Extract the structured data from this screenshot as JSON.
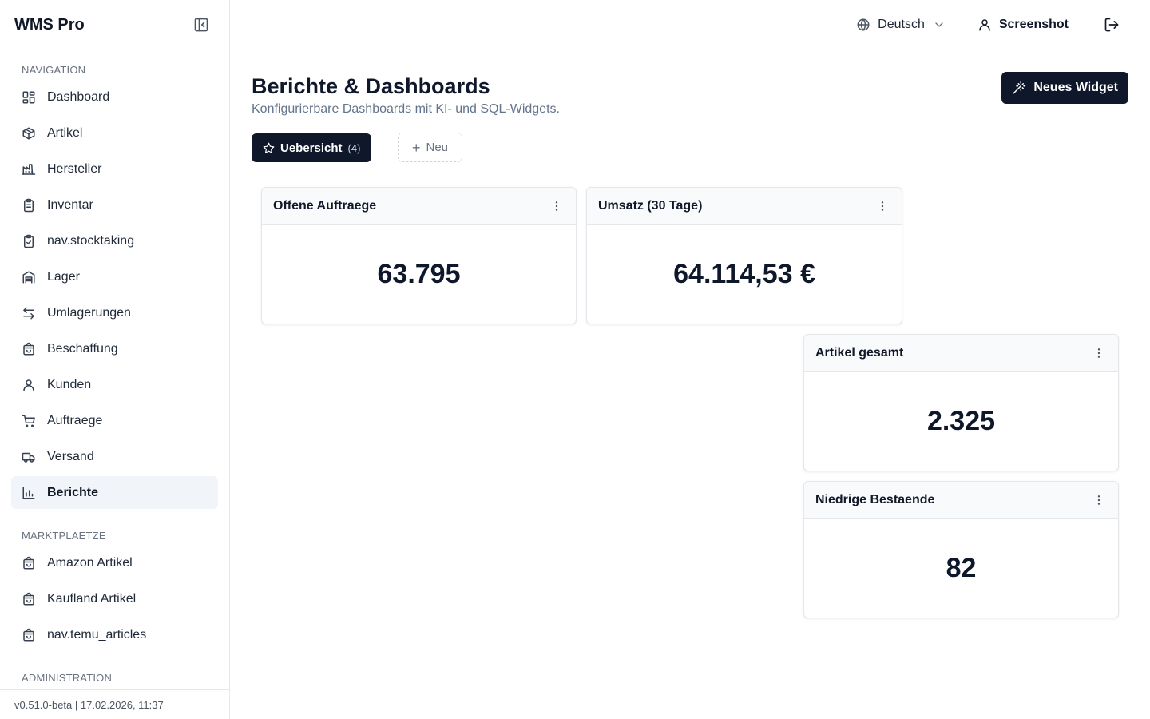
{
  "app": {
    "title": "WMS Pro",
    "version": "v0.51.0-beta | 17.02.2026, 11:37"
  },
  "sidebar": {
    "sections": [
      {
        "title": "NAVIGATION"
      },
      {
        "title": "MARKTPLAETZE"
      },
      {
        "title": "ADMINISTRATION"
      }
    ],
    "navigation": [
      {
        "label": "Dashboard",
        "icon": "layout-grid-icon"
      },
      {
        "label": "Artikel",
        "icon": "package-icon"
      },
      {
        "label": "Hersteller",
        "icon": "factory-icon"
      },
      {
        "label": "Inventar",
        "icon": "clipboard-list-icon"
      },
      {
        "label": "nav.stocktaking",
        "icon": "clipboard-check-icon"
      },
      {
        "label": "Lager",
        "icon": "warehouse-icon"
      },
      {
        "label": "Umlagerungen",
        "icon": "arrow-left-right-icon"
      },
      {
        "label": "Beschaffung",
        "icon": "shopping-bag-icon"
      },
      {
        "label": "Kunden",
        "icon": "user-icon"
      },
      {
        "label": "Auftraege",
        "icon": "shopping-cart-icon"
      },
      {
        "label": "Versand",
        "icon": "truck-icon"
      },
      {
        "label": "Berichte",
        "icon": "bar-chart-icon",
        "active": true
      }
    ],
    "marketplaces": [
      {
        "label": "Amazon Artikel",
        "icon": "shopping-bag-icon"
      },
      {
        "label": "Kaufland Artikel",
        "icon": "shopping-bag-icon"
      },
      {
        "label": "nav.temu_articles",
        "icon": "shopping-bag-icon"
      }
    ]
  },
  "topbar": {
    "language": "Deutsch",
    "user": "Screenshot"
  },
  "main": {
    "title": "Berichte & Dashboards",
    "subtitle": "Konfigurierbare Dashboards mit KI- und SQL-Widgets.",
    "new_widget_label": "Neues Widget",
    "tabs": {
      "active_label": "Uebersicht",
      "active_count": "(4)",
      "new_label": "Neu"
    }
  },
  "widgets": [
    {
      "title": "Offene Auftraege",
      "value": "63.795"
    },
    {
      "title": "Umsatz (30 Tage)",
      "value": "64.114,53 €"
    },
    {
      "title": "Artikel gesamt",
      "value": "2.325"
    },
    {
      "title": "Niedrige Bestaende",
      "value": "82"
    }
  ],
  "colors": {
    "primary": "#0f172a",
    "muted": "#64748b",
    "border": "#e5e7eb",
    "active_bg": "#f1f5f9"
  }
}
